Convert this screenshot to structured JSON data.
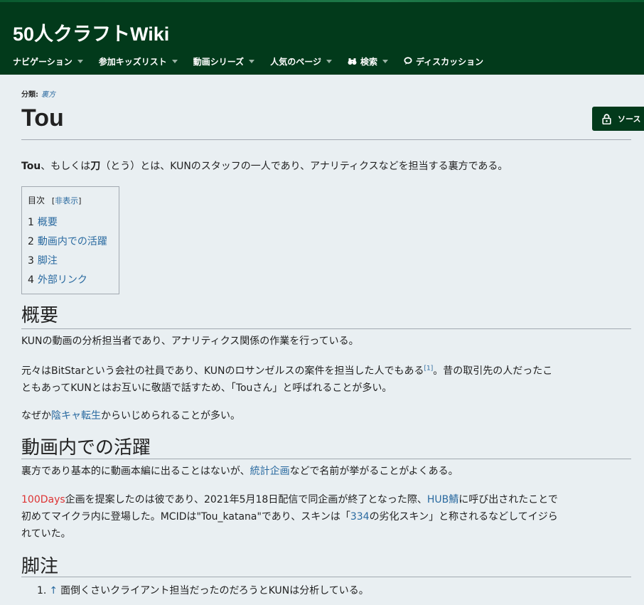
{
  "header": {
    "site_title": "50人クラフトWiki",
    "nav": [
      {
        "label": "ナビゲーション",
        "icon": "",
        "dropdown": true
      },
      {
        "label": "参加キッズリスト",
        "icon": "",
        "dropdown": true
      },
      {
        "label": "動画シリーズ",
        "icon": "",
        "dropdown": true
      },
      {
        "label": "人気のページ",
        "icon": "",
        "dropdown": true
      },
      {
        "label": "検索",
        "icon": "binoculars-icon",
        "dropdown": true
      },
      {
        "label": "ディスカッション",
        "icon": "speech-bubble-icon",
        "dropdown": false
      }
    ]
  },
  "page": {
    "category_label": "分類:",
    "category_link": "裏方",
    "title": "Tou",
    "source_button": "ソース"
  },
  "intro": {
    "bold1": "Tou",
    "text1": "、もしくは",
    "bold2": "刀",
    "text2": "（とう）とは、KUNのスタッフの一人であり、アナリティクスなどを担当する裏方である。"
  },
  "toc": {
    "title": "目次",
    "hide_open": "[",
    "hide_label": "非表示",
    "hide_close": "]",
    "items": [
      {
        "num": "1",
        "label": "概要"
      },
      {
        "num": "2",
        "label": "動画内での活躍"
      },
      {
        "num": "3",
        "label": "脚注"
      },
      {
        "num": "4",
        "label": "外部リンク"
      }
    ]
  },
  "section_overview": {
    "heading": "概要",
    "p1": "KUNの動画の分析担当者であり、アナリティクス関係の作業を行っている。",
    "p2_a": "元々はBitStarという会社の社員であり、KUNのロサンゼルスの案件を担当した人でもある",
    "p2_ref": "[1]",
    "p2_b": "。昔の取引先の人だったこ",
    "p2_c": "ともあってKUNとはお互いに敬語で話すため、「Touさん」と呼ばれることが多い。",
    "p3_a": "なぜか",
    "p3_link": "陰キャ転生",
    "p3_b": "からいじめられることが多い。"
  },
  "section_activity": {
    "heading": "動画内での活躍",
    "p1_a": "裏方であり基本的に動画本編に出ることはないが、",
    "p1_link": "統計企画",
    "p1_b": "などで名前が挙がることがよくある。",
    "p2_redlink": "100Days",
    "p2_a": "企画を提案したのは彼であり、2021年5月18日配信で同企画が終了となった際、",
    "p2_link": "HUB鯖",
    "p2_b": "に呼び出されたことで",
    "p2_c": "初めてマイクラ内に登場した。MCIDは\"Tou_katana\"であり、スキンは「",
    "p2_link2": "334",
    "p2_d": "の劣化スキン」と称されるなどしてイジら",
    "p2_e": "れていた。"
  },
  "section_notes": {
    "heading": "脚注",
    "ref_num": "1.",
    "ref_arrow": "↑",
    "ref_text": "面倒くさいクライアント担当だったのだろうとKUNは分析している。"
  }
}
